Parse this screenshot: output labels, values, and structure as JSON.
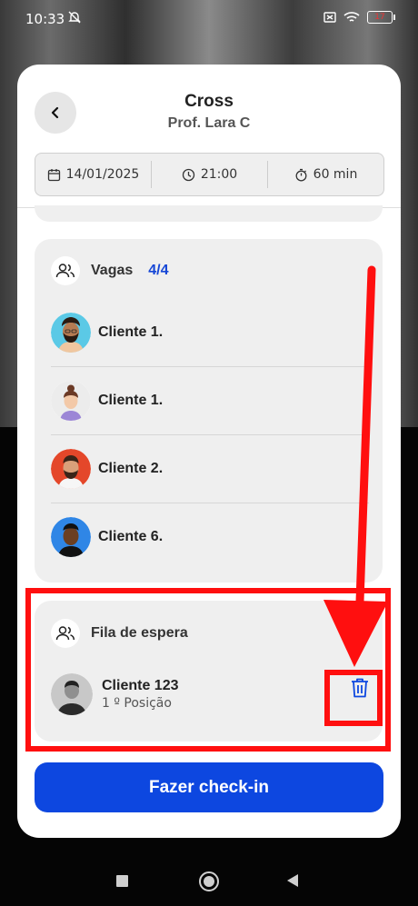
{
  "status_bar": {
    "time": "10:33",
    "battery": "17"
  },
  "header": {
    "title": "Cross",
    "subtitle": "Prof. Lara C"
  },
  "info": {
    "date": "14/01/2025",
    "time": "21:00",
    "duration": "60 min"
  },
  "vagas": {
    "label": "Vagas",
    "count": "4/4",
    "clients": [
      {
        "name": "Cliente 1.",
        "avatar": "avatar-man-beard-icon"
      },
      {
        "name": "Cliente 1.",
        "avatar": "avatar-woman-bun-icon"
      },
      {
        "name": "Cliente 2.",
        "avatar": "avatar-man-red-icon"
      },
      {
        "name": "Cliente 6.",
        "avatar": "avatar-man-blue-icon"
      }
    ]
  },
  "waitlist": {
    "label": "Fila de espera",
    "client": {
      "name": "Cliente 123",
      "position": "1 º Posição"
    }
  },
  "checkin_label": "Fazer check-in",
  "colors": {
    "accent": "#0d47e0",
    "count": "#1546d6",
    "annotation": "#ff0f0f"
  }
}
